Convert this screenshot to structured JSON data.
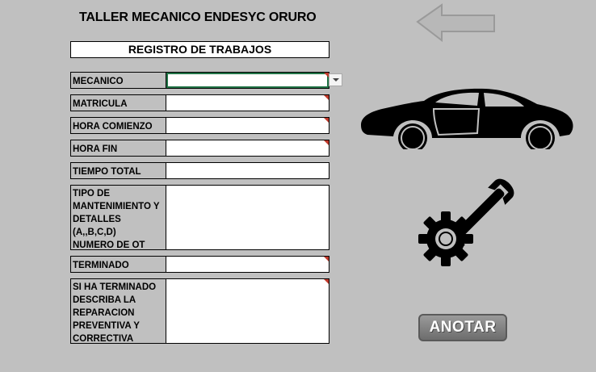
{
  "header": {
    "title": "TALLER MECANICO ENDESYC ORURO"
  },
  "section": {
    "title": "REGISTRO  DE TRABAJOS"
  },
  "form": {
    "fields": [
      {
        "label": "MECANICO",
        "value": ""
      },
      {
        "label": "MATRICULA",
        "value": ""
      },
      {
        "label": "HORA COMIENZO",
        "value": ""
      },
      {
        "label": "HORA FIN",
        "value": ""
      },
      {
        "label": "TIEMPO TOTAL",
        "value": ""
      },
      {
        "label": "TIPO DE\nMANTENIMIENTO Y\nDETALLES (A,,B,C,D)\nNUMERO DE OT",
        "value": ""
      },
      {
        "label": "TERMINADO",
        "value": ""
      },
      {
        "label": "SI HA TERMINADO\nDESCRIBA LA\nREPARACION\nPREVENTIVA Y\nCORRECTIVA",
        "value": ""
      }
    ]
  },
  "buttons": {
    "anotar": "ANOTAR"
  },
  "icons": {
    "back": "back-arrow-icon",
    "car": "car-icon",
    "tools": "gear-wrench-icon"
  }
}
